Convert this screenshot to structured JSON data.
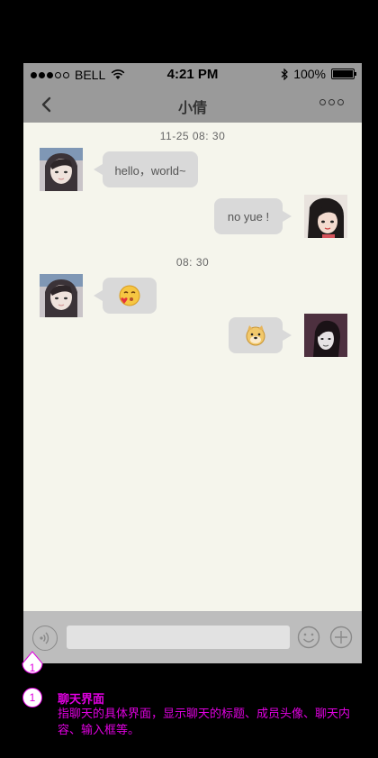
{
  "status_bar": {
    "carrier": "BELL",
    "time": "4:21 PM",
    "battery": "100%"
  },
  "nav": {
    "title": "小倩"
  },
  "chat": {
    "timestamps": [
      "11-25 08: 30",
      "08: 30"
    ],
    "messages": [
      {
        "side": "left",
        "text": "hello，world~"
      },
      {
        "side": "right",
        "text": "no yue !"
      },
      {
        "side": "left",
        "emoji": "kiss-face-icon"
      },
      {
        "side": "right",
        "emoji": "doge-icon"
      }
    ]
  },
  "input": {
    "placeholder": ""
  },
  "annotation": {
    "number": "1",
    "title": "聊天界面",
    "description": "指聊天的具体界面，显示聊天的标题、成员头像、聊天内容、输入框等。"
  },
  "colors": {
    "bar": "#9a9a9a",
    "chat_bg": "#f5f5ec",
    "bubble": "#d9d9d9",
    "annotation": "#e000e0"
  }
}
